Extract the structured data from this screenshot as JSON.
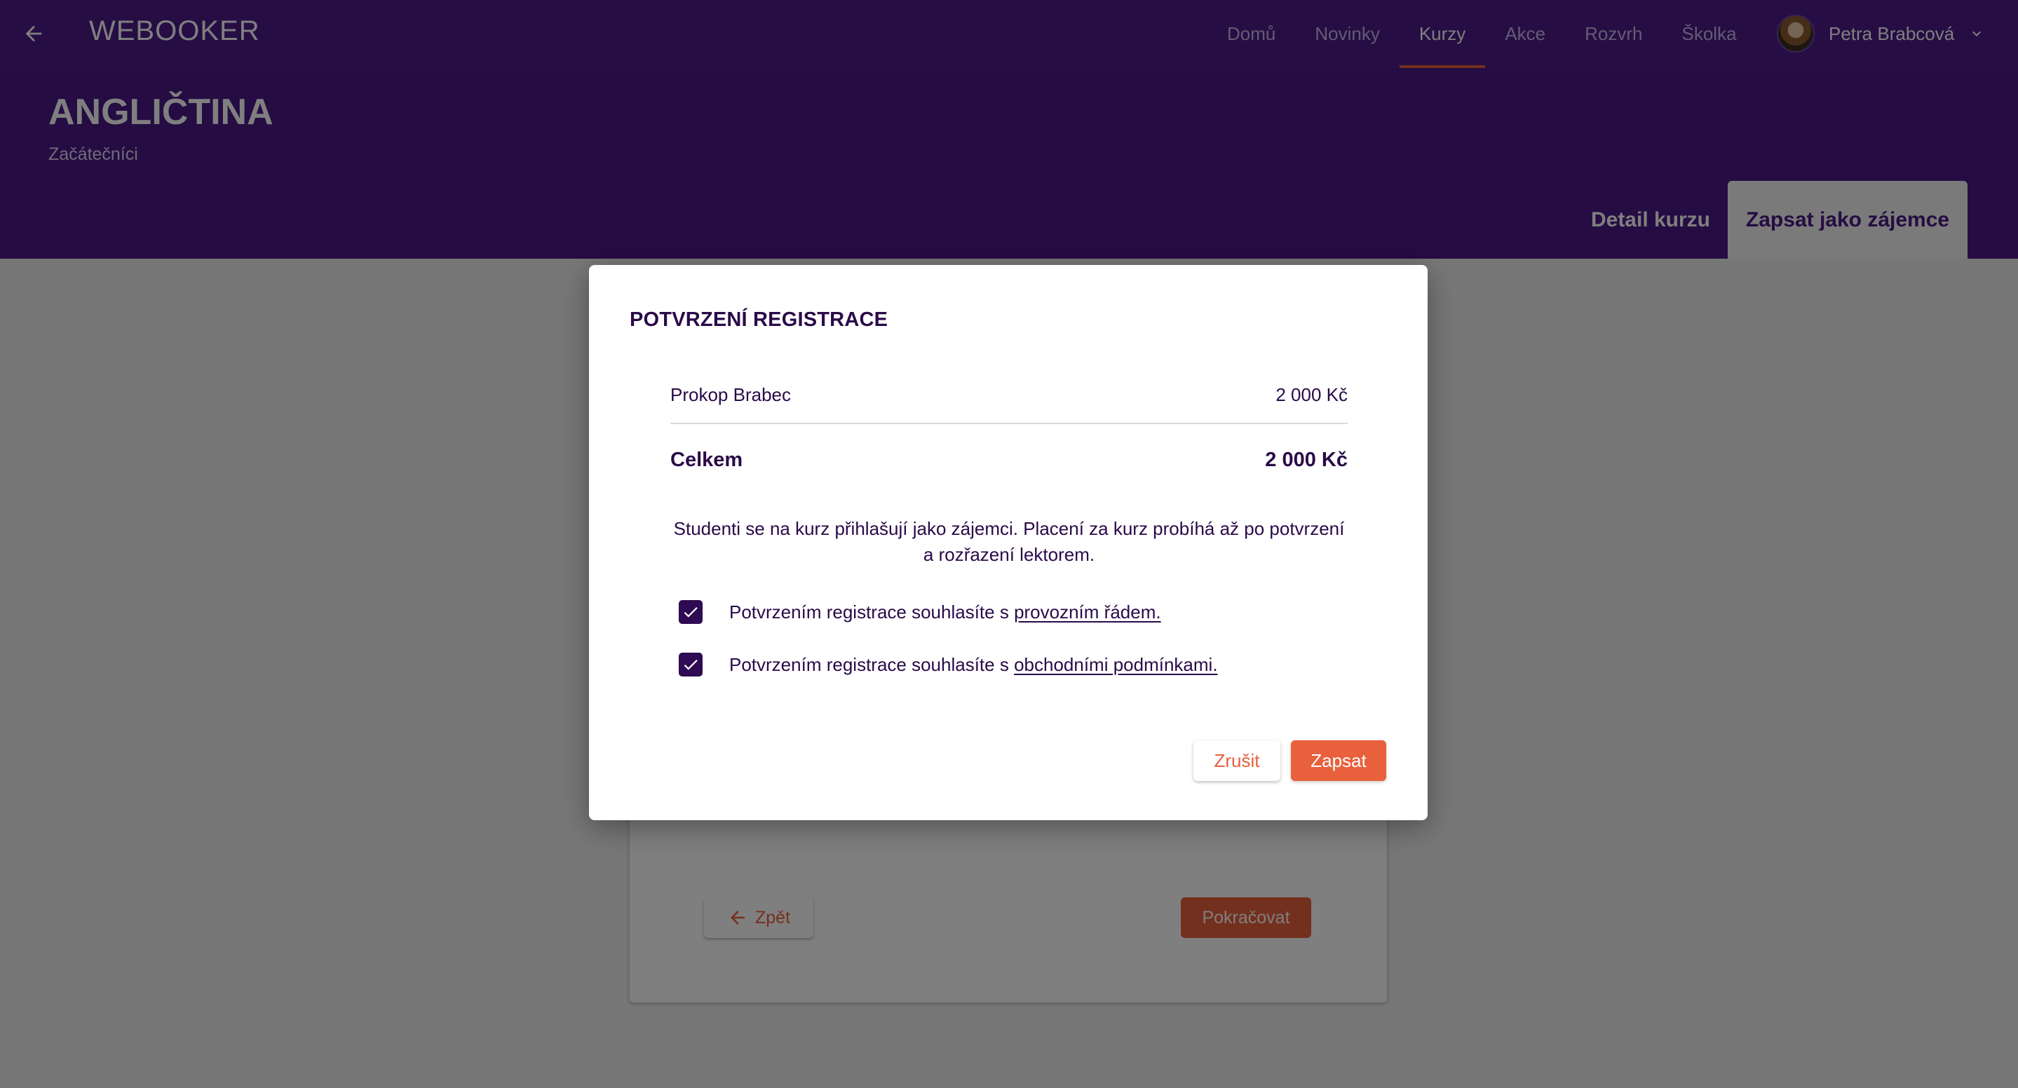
{
  "header": {
    "brand": "WEBOOKER",
    "back_icon": "arrow-left-icon",
    "nav": [
      {
        "label": "Domů",
        "active": false
      },
      {
        "label": "Novinky",
        "active": false
      },
      {
        "label": "Kurzy",
        "active": true
      },
      {
        "label": "Akce",
        "active": false
      },
      {
        "label": "Rozvrh",
        "active": false
      },
      {
        "label": "Školka",
        "active": false
      }
    ],
    "user": {
      "name": "Petra Brabcová",
      "menu_icon": "chevron-down-icon"
    }
  },
  "hero": {
    "title": "ANGLIČTINA",
    "subtitle": "Začátečníci",
    "tabs": [
      {
        "label": "Detail kurzu",
        "active": false
      },
      {
        "label": "Zapsat jako zájemce",
        "active": true
      }
    ]
  },
  "card": {
    "back_label": "Zpět",
    "next_label": "Pokračovat"
  },
  "modal": {
    "title": "POTVRZENÍ REGISTRACE",
    "item": {
      "name": "Prokop Brabec",
      "price": "2 000 Kč"
    },
    "total": {
      "label": "Celkem",
      "price": "2 000 Kč"
    },
    "info_line1": "Studenti se na kurz přihlašují jako zájemci. Placení za kurz probíhá až po potvrzení",
    "info_line2": "a rozřazení lektorem.",
    "checks": [
      {
        "checked": true,
        "text": "Potvrzením registrace souhlasíte s ",
        "link": "provozním řádem."
      },
      {
        "checked": true,
        "text": "Potvrzením registrace souhlasíte s ",
        "link": "obchodními podmínkami."
      }
    ],
    "cancel_label": "Zrušit",
    "submit_label": "Zapsat"
  },
  "colors": {
    "primary": "#4a1886",
    "accent": "#e8603c",
    "text_dark": "#2a0a48"
  }
}
